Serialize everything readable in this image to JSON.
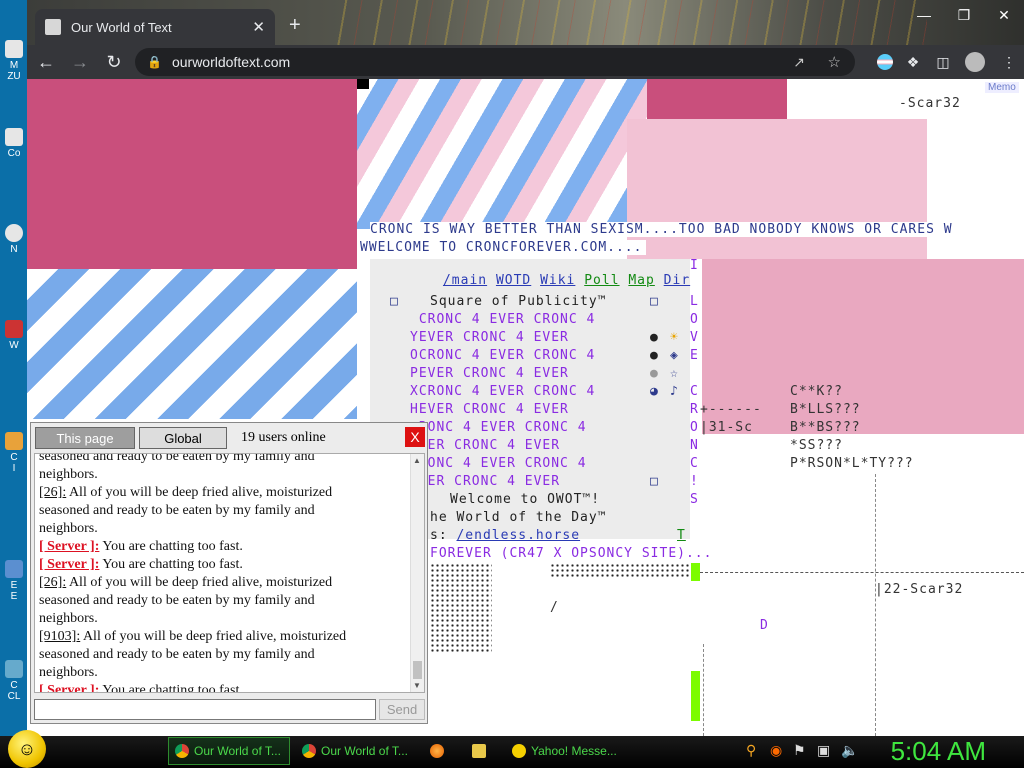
{
  "browser": {
    "tab_title": "Our World of Text",
    "url": "ourworldoftext.com",
    "new_tab": "+",
    "close_tab": "✕",
    "window_controls": [
      "—",
      "❐",
      "✕"
    ]
  },
  "owot": {
    "memo_label": "Memo",
    "scar_top": "-Scar32",
    "line1": "CRONC IS WAY BETTER THAN SEXISM....TOO BAD NOBODY KNOWS OR CARES W",
    "line2": "WWELCOME TO CRONCFOREVER.COM....",
    "links": [
      "/main",
      "WOTD",
      "Wiki",
      "Poll",
      "Map",
      "Dir"
    ],
    "square_title": "Square of Publicity™",
    "cronc_rows": [
      " CRONC 4 EVER CRONC 4",
      "YEVER CRONC 4 EVER",
      "OCRONC 4 EVER CRONC 4",
      "PEVER CRONC 4 EVER",
      "XCRONC 4 EVER CRONC 4",
      "HEVER CRONC 4 EVER",
      " RONC 4 EVER CRONC 4",
      " VER CRONC 4 EVER",
      " RONC 4 EVER CRONC 4",
      " VER CRONC 4 EVER"
    ],
    "welcome": "Welcome to OWOT™!",
    "wotd": "he World of the Day™",
    "wotd_prefix": "s: ",
    "wotd_link": "/endless.horse",
    "forever": "FOREVER (CR47 X OPSONCY SITE)...",
    "side_letters": [
      "I",
      "",
      "L",
      "O",
      "V",
      "E",
      "",
      "C",
      "R",
      "O",
      "N",
      "C",
      "!",
      "S"
    ],
    "censor": [
      "C**K??",
      "B*LLS???",
      "B**BS???",
      "*SS???",
      "P*RSON*L*TY???"
    ],
    "dashes": "+------",
    "sc31": "|31-Sc",
    "scar22": "|22-Scar32",
    "letter_d": "D",
    "letter_t": "T",
    "slash": "/"
  },
  "chat": {
    "tab_page": "This page",
    "tab_global": "Global",
    "users_online": "19 users online",
    "close": "X",
    "send": "Send",
    "input_value": "",
    "messages": [
      {
        "nick": "",
        "text": "seasoned and ready to be eaten by my family and",
        "server": false
      },
      {
        "nick": "",
        "text": "neighbors.",
        "server": false
      },
      {
        "nick": "[26]:",
        "text": " All of you will be deep fried alive, moisturized",
        "server": false
      },
      {
        "nick": "",
        "text": "seasoned and ready to be eaten by my family and",
        "server": false
      },
      {
        "nick": "",
        "text": "neighbors.",
        "server": false
      },
      {
        "nick": "[ Server ]:",
        "text": " You are chatting too fast.",
        "server": true
      },
      {
        "nick": "[ Server ]:",
        "text": " You are chatting too fast.",
        "server": true
      },
      {
        "nick": "[26]:",
        "text": " All of you will be deep fried alive, moisturized",
        "server": false
      },
      {
        "nick": "",
        "text": "seasoned and ready to be eaten by my family and",
        "server": false
      },
      {
        "nick": "",
        "text": "neighbors.",
        "server": false
      },
      {
        "nick": "[9103]:",
        "text": " All of you will be deep fried alive, moisturized",
        "server": false
      },
      {
        "nick": "",
        "text": "seasoned and ready to be eaten by my family and",
        "server": false
      },
      {
        "nick": "",
        "text": "neighbors.",
        "server": false
      },
      {
        "nick": "[ Server ]:",
        "text": " You are chatting too fast.",
        "server": true
      }
    ]
  },
  "taskbar": {
    "tasks": [
      "Our World of T...",
      "Our World of T...",
      "",
      "",
      "Yahoo! Messe..."
    ],
    "clock": "5:04 AM"
  },
  "desktop_icons": [
    "M\nZU",
    "Co",
    "N",
    "W",
    "C\nI",
    "E\nE",
    "G\nCL"
  ]
}
